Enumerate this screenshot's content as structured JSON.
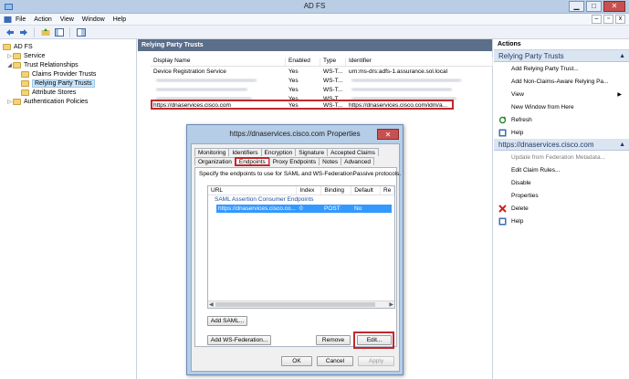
{
  "window": {
    "title": "AD FS",
    "min": "▁",
    "max": "□",
    "close": "✕"
  },
  "menu": {
    "items": [
      "File",
      "Action",
      "View",
      "Window",
      "Help"
    ],
    "right": [
      "–",
      "▫",
      "x"
    ]
  },
  "tree": {
    "root": "AD FS",
    "items": [
      {
        "label": "Service",
        "level": 1,
        "expander": "▷"
      },
      {
        "label": "Trust Relationships",
        "level": 1,
        "expander": "◢"
      },
      {
        "label": "Claims Provider Trusts",
        "level": 2,
        "expander": ""
      },
      {
        "label": "Relying Party Trusts",
        "level": 2,
        "expander": "",
        "selected": true
      },
      {
        "label": "Attribute Stores",
        "level": 2,
        "expander": ""
      },
      {
        "label": "Authentication Policies",
        "level": 1,
        "expander": "▷"
      }
    ]
  },
  "center": {
    "header": "Relying Party Trusts",
    "columns": [
      "Display Name",
      "Enabled",
      "Type",
      "Identifier"
    ],
    "rows": [
      {
        "name": "Device Registration Service",
        "enabled": "Yes",
        "type": "WS-T...",
        "identifier": "urn:ms-drs:adfs-1.assurance.sol.local"
      },
      {
        "name": "",
        "enabled": "Yes",
        "type": "WS-T...",
        "identifier": ""
      },
      {
        "name": "",
        "enabled": "Yes",
        "type": "WS-T...",
        "identifier": ""
      },
      {
        "name": "",
        "enabled": "Yes",
        "type": "WS-T...",
        "identifier": ""
      },
      {
        "name": "https://dnaservices.cisco.com",
        "enabled": "Yes",
        "type": "WS-T...",
        "identifier": "https://dnaservices.cisco.com/idm/a..."
      }
    ]
  },
  "actions": {
    "header": "Actions",
    "section1": "Relying Party Trusts",
    "items1": [
      {
        "label": "Add Relying Party Trust...",
        "icon": ""
      },
      {
        "label": "Add Non-Claims-Aware Relying Pa...",
        "icon": ""
      },
      {
        "label": "View",
        "icon": "",
        "submenu": "▶"
      },
      {
        "label": "New Window from Here",
        "icon": ""
      },
      {
        "label": "Refresh",
        "icon": "refresh-icon"
      },
      {
        "label": "Help",
        "icon": "help-icon"
      }
    ],
    "section2": "https://dnaservices.cisco.com",
    "items2": [
      {
        "label": "Update from Federation Metadata...",
        "disabled": true
      },
      {
        "label": "Edit Claim Rules..."
      },
      {
        "label": "Disable"
      },
      {
        "label": "Properties"
      },
      {
        "label": "Delete",
        "icon": "delete-icon"
      },
      {
        "label": "Help",
        "icon": "help-icon"
      }
    ],
    "collapse_arrow": "▲"
  },
  "dialog": {
    "title": "https://dnaservices.cisco.com Properties",
    "close": "✕",
    "tabs_top": [
      "Monitoring",
      "Identifiers",
      "Encryption",
      "Signature",
      "Accepted Claims"
    ],
    "tabs_bottom": [
      "Organization",
      "Endpoints",
      "Proxy Endpoints",
      "Notes",
      "Advanced"
    ],
    "active_tab": "Endpoints",
    "description": "Specify the endpoints to use for SAML and WS-FederationPassive protocols.",
    "ep_columns": [
      "URL",
      "Index",
      "Binding",
      "Default",
      "Re"
    ],
    "ep_group": "SAML Assertion Consumer Endpoints",
    "ep_row": {
      "url": "https://dnaservices.cisco.co...",
      "index": "0",
      "binding": "POST",
      "default": "No"
    },
    "scroll_left": "◀",
    "scroll_right": "▶",
    "buttons": {
      "add_saml": "Add SAML...",
      "add_wsfed": "Add WS-Federation...",
      "remove": "Remove",
      "edit": "Edit...",
      "ok": "OK",
      "cancel": "Cancel",
      "apply": "Apply"
    }
  }
}
